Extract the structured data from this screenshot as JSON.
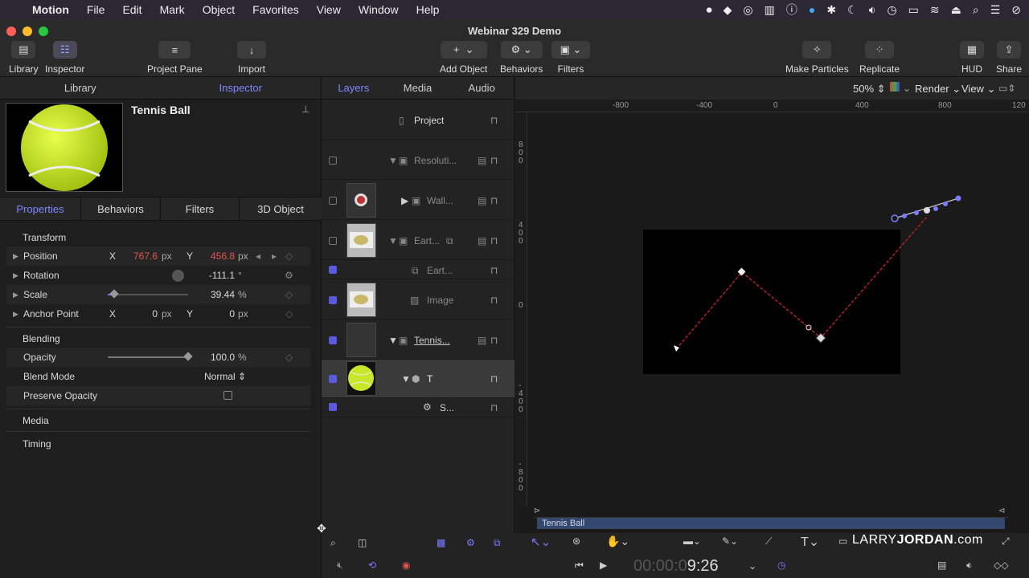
{
  "menubar": {
    "apple": "",
    "app": "Motion",
    "items": [
      "File",
      "Edit",
      "Mark",
      "Object",
      "Favorites",
      "View",
      "Window",
      "Help"
    ]
  },
  "window": {
    "title": "Webinar 329 Demo"
  },
  "toolbar": {
    "library": "Library",
    "inspector": "Inspector",
    "project_pane": "Project Pane",
    "import": "Import",
    "add_object": "Add Object",
    "behaviors": "Behaviors",
    "filters": "Filters",
    "make_particles": "Make Particles",
    "replicate": "Replicate",
    "hud": "HUD",
    "share": "Share"
  },
  "left": {
    "tabs": {
      "library": "Library",
      "inspector": "Inspector"
    },
    "preview_title": "Tennis Ball",
    "subtabs": [
      "Properties",
      "Behaviors",
      "Filters",
      "3D Object"
    ],
    "transform": {
      "header": "Transform",
      "position": {
        "label": "Position",
        "x_label": "X",
        "x": "767.6",
        "unit": "px",
        "y_label": "Y",
        "y": "456.8",
        "unit2": "px"
      },
      "rotation": {
        "label": "Rotation",
        "value": "-111.1",
        "unit": "°"
      },
      "scale": {
        "label": "Scale",
        "value": "39.44",
        "unit": "%",
        "level": 0.08
      },
      "anchor": {
        "label": "Anchor Point",
        "x_label": "X",
        "x": "0",
        "unit": "px",
        "y_label": "Y",
        "y": "0",
        "unit2": "px"
      }
    },
    "blending": {
      "header": "Blending",
      "opacity": {
        "label": "Opacity",
        "value": "100.0",
        "unit": "%",
        "level": 1.0
      },
      "blend_mode": {
        "label": "Blend Mode",
        "value": "Normal"
      },
      "preserve_opacity": {
        "label": "Preserve Opacity",
        "checked": false
      }
    },
    "media": "Media",
    "timing": "Timing"
  },
  "layers": {
    "tabs": {
      "layers": "Layers",
      "media": "Media",
      "audio": "Audio"
    },
    "rows": [
      {
        "name": "Project"
      },
      {
        "name": "Resoluti..."
      },
      {
        "name": "Wall..."
      },
      {
        "name": "Eart..."
      },
      {
        "name": "Eart..."
      },
      {
        "name": "Image"
      },
      {
        "name": "Tennis..."
      },
      {
        "name": "T"
      },
      {
        "name": "S..."
      }
    ]
  },
  "canvas": {
    "zoom": "50%",
    "render": "Render",
    "view": "View",
    "ruler_h": [
      "-800",
      "-400",
      "0",
      "400",
      "800",
      "120"
    ],
    "ruler_v": [
      "8\n0\n0",
      "4\n0\n0",
      "0",
      "-\n4\n0\n0",
      "-\n8\n0\n0"
    ],
    "timeline_label": "Tennis Ball"
  },
  "bottom": {
    "timecode_dim": "00:00:0",
    "timecode": "9:26",
    "watermark_prefix": "LARRY",
    "watermark_bold": "JORDAN",
    "watermark_suffix": ".com"
  },
  "colors": {
    "accent": "#7e86ff",
    "red_value": "#e0554f",
    "path": "#b41e24",
    "tennis": "#c8e62a"
  }
}
